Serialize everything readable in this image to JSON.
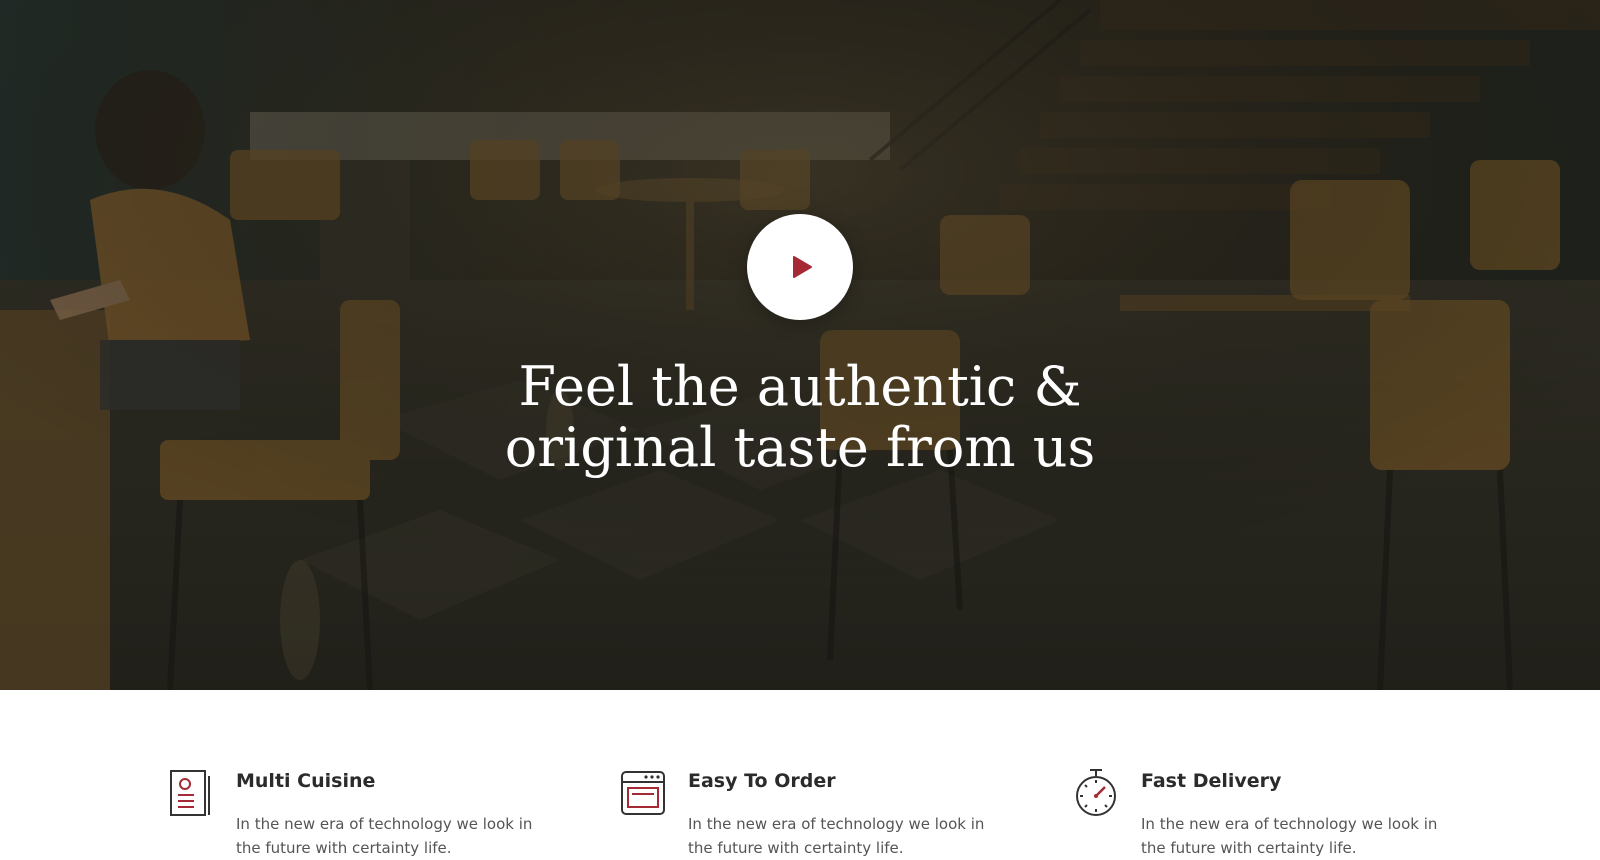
{
  "colors": {
    "accent": "#a52a36",
    "icon_stroke": "#333333",
    "hero_overlay": "#1f2018",
    "title_text": "#ffffff",
    "body_text": "#555555",
    "heading_text": "#2b2b2b"
  },
  "hero": {
    "title_line1": "Feel the authentic &",
    "title_line2": "original taste from us",
    "play_button_icon": "play-icon"
  },
  "features": [
    {
      "icon": "menu-card-icon",
      "title": "Multi Cuisine",
      "text": "In the new era of technology we look in the future with certainty life."
    },
    {
      "icon": "oven-icon",
      "title": "Easy To Order",
      "text": "In the new era of technology we look in the future with certainty life."
    },
    {
      "icon": "stopwatch-icon",
      "title": "Fast Delivery",
      "text": "In the new era of technology we look in the future with certainty life."
    }
  ]
}
